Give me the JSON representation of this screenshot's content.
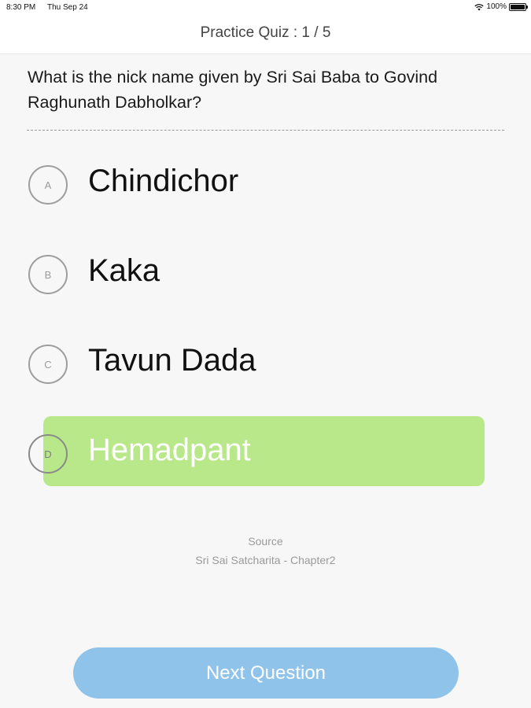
{
  "status_bar": {
    "time": "8:30 PM",
    "date": "Thu Sep 24",
    "battery": "100%"
  },
  "nav": {
    "title": "Practice Quiz : 1 / 5"
  },
  "question": {
    "text": "What is the nick name given by Sri Sai Baba to Govind Raghunath Dabholkar?"
  },
  "options": [
    {
      "letter": "A",
      "label": "Chindichor",
      "selected": false
    },
    {
      "letter": "B",
      "label": "Kaka",
      "selected": false
    },
    {
      "letter": "C",
      "label": "Tavun Dada",
      "selected": false
    },
    {
      "letter": "D",
      "label": "Hemadpant",
      "selected": true
    }
  ],
  "source": {
    "label": "Source",
    "value": "Sri Sai Satcharita - Chapter2"
  },
  "next_button": {
    "label": "Next Question"
  },
  "colors": {
    "correct_highlight": "#b9e88b",
    "next_button": "#90c3ea"
  }
}
